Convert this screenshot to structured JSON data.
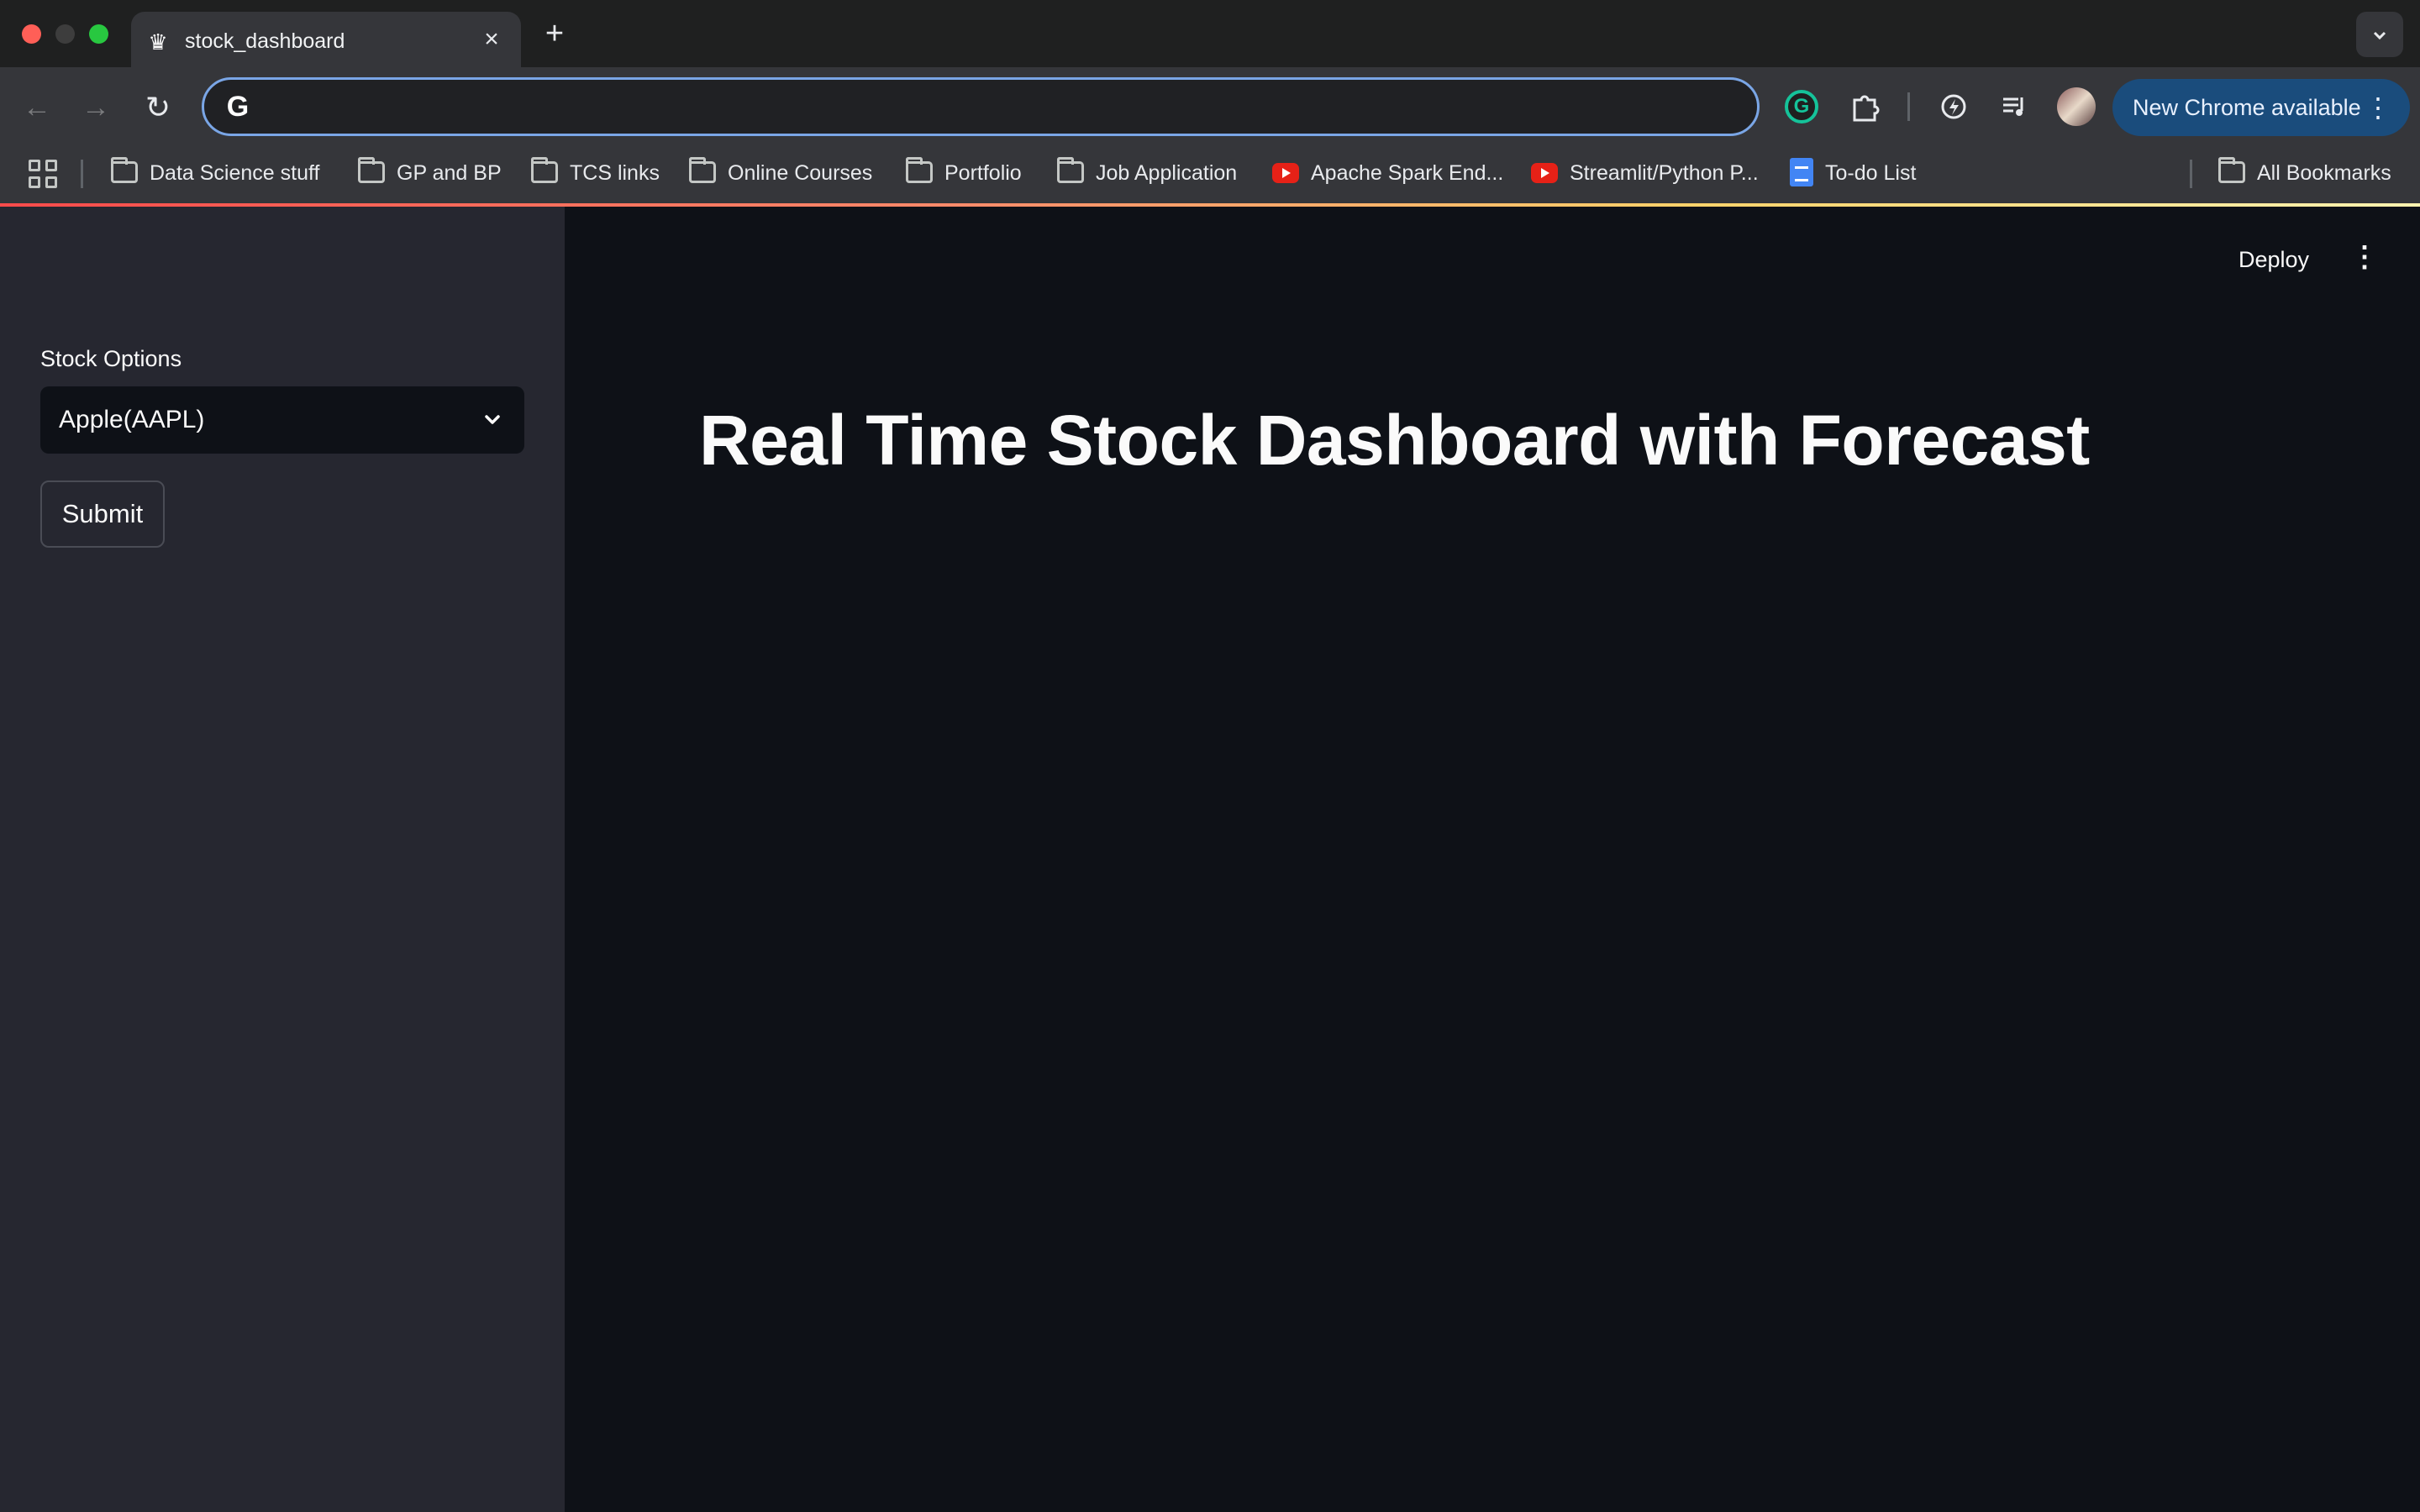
{
  "browser": {
    "tab": {
      "title": "stock_dashboard",
      "favicon": "crown-icon"
    },
    "new_tab_label": "+",
    "omnibox": {
      "value": "",
      "placeholder": ""
    },
    "update_button": "New Chrome available",
    "bookmarks": [
      {
        "label": "Data Science stuff",
        "icon": "folder-icon"
      },
      {
        "label": "GP and BP",
        "icon": "folder-icon"
      },
      {
        "label": "TCS links",
        "icon": "folder-icon"
      },
      {
        "label": "Online Courses",
        "icon": "folder-icon"
      },
      {
        "label": "Portfolio",
        "icon": "folder-icon"
      },
      {
        "label": "Job Application",
        "icon": "folder-icon"
      },
      {
        "label": "Apache Spark End...",
        "icon": "youtube-icon"
      },
      {
        "label": "Streamlit/Python P...",
        "icon": "youtube-icon"
      },
      {
        "label": "To-do List",
        "icon": "google-docs-icon"
      }
    ],
    "all_bookmarks": "All Bookmarks"
  },
  "sidebar": {
    "select_label": "Stock Options",
    "select_value": "Apple(AAPL)",
    "submit_label": "Submit"
  },
  "main": {
    "deploy_label": "Deploy",
    "title": "Real Time Stock Dashboard with Forecast"
  },
  "colors": {
    "sidebar_bg": "#262730",
    "main_bg": "#0e1117",
    "update_button_bg": "#1a4c7c",
    "omnibox_focus": "#7aa6e6"
  }
}
